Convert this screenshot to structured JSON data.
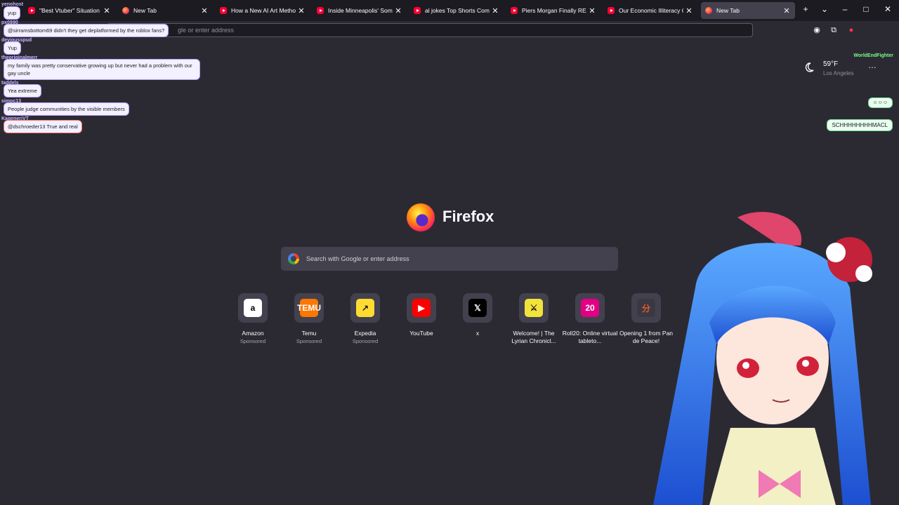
{
  "tabs": [
    {
      "title": "\"Best Vtuber\" Situation Is A",
      "icon": "youtube-favicon"
    },
    {
      "title": "New Tab",
      "icon": "firefox-favicon"
    },
    {
      "title": "How a New AI Art Method I",
      "icon": "youtube-favicon"
    },
    {
      "title": "Inside Minneapolis' Somali",
      "icon": "youtube-favicon"
    },
    {
      "title": "al jokes Top Shorts Compilat",
      "icon": "youtube-favicon"
    },
    {
      "title": "Piers Morgan Finally REALIZ",
      "icon": "youtube-favicon"
    },
    {
      "title": "Our Economic Illiteracy Crisi",
      "icon": "youtube-favicon"
    },
    {
      "title": "New Tab",
      "icon": "firefox-favicon"
    }
  ],
  "toolbar": {
    "address_placeholder": "gle or enter address"
  },
  "weather": {
    "temp": "59°F",
    "city": "Los Angeles"
  },
  "hero": {
    "brand": "Firefox",
    "search_placeholder": "Search with Google or enter address"
  },
  "shortcuts": [
    {
      "label": "Amazon",
      "sub": "Sponsored",
      "icon": "amazon-icon",
      "bg": "#ffffff",
      "fg": "#000000",
      "glyph": "a"
    },
    {
      "label": "Temu",
      "sub": "Sponsored",
      "icon": "temu-icon",
      "bg": "#fb7701",
      "fg": "#ffffff",
      "glyph": "TEMU"
    },
    {
      "label": "Expedia",
      "sub": "Sponsored",
      "icon": "expedia-icon",
      "bg": "#fddb32",
      "fg": "#1a1a1a",
      "glyph": "↗"
    },
    {
      "label": "YouTube",
      "sub": "",
      "icon": "youtube-icon",
      "bg": "#ff0000",
      "fg": "#ffffff",
      "glyph": "▶"
    },
    {
      "label": "x",
      "sub": "",
      "icon": "x-icon",
      "bg": "#000000",
      "fg": "#ffffff",
      "glyph": "𝕏"
    },
    {
      "label": "Welcome! | The Lyrian Chronicl...",
      "sub": "",
      "icon": "lyrian-icon",
      "bg": "#f2e33a",
      "fg": "#1a1a1a",
      "glyph": "⚔"
    },
    {
      "label": "Roll20: Online virtual tableto...",
      "sub": "",
      "icon": "roll20-icon",
      "bg": "#e10085",
      "fg": "#ffffff",
      "glyph": "20"
    },
    {
      "label": "Opening 1 from Pan de Peace!",
      "sub": "",
      "icon": "pan-de-peace-icon",
      "bg": "#3a3943",
      "fg": "#e25a2a",
      "glyph": "分"
    }
  ],
  "chat": [
    {
      "user": "yenohost",
      "text": "yup"
    },
    {
      "user": "px0990",
      "text": "@sirramsbottom69 didn't they get deplatformed by the roblox fans?"
    },
    {
      "user": "deviousspud",
      "text": "Yup"
    },
    {
      "user": "theoriginalmerr",
      "text": "my family was pretty conservative growing up but never had a problem with our gay uncle"
    },
    {
      "user": "taddels",
      "text": "Yea extreme"
    },
    {
      "user": "simoc13",
      "text": "People judge communities by the visible members"
    },
    {
      "user": "KageneriVT",
      "text": "@dschroeder13 True and real"
    }
  ],
  "right_chat": [
    {
      "user": "WorldEndFighter",
      "text": ""
    },
    {
      "user": "",
      "text": "SCHHHHHHHHMACL"
    }
  ]
}
